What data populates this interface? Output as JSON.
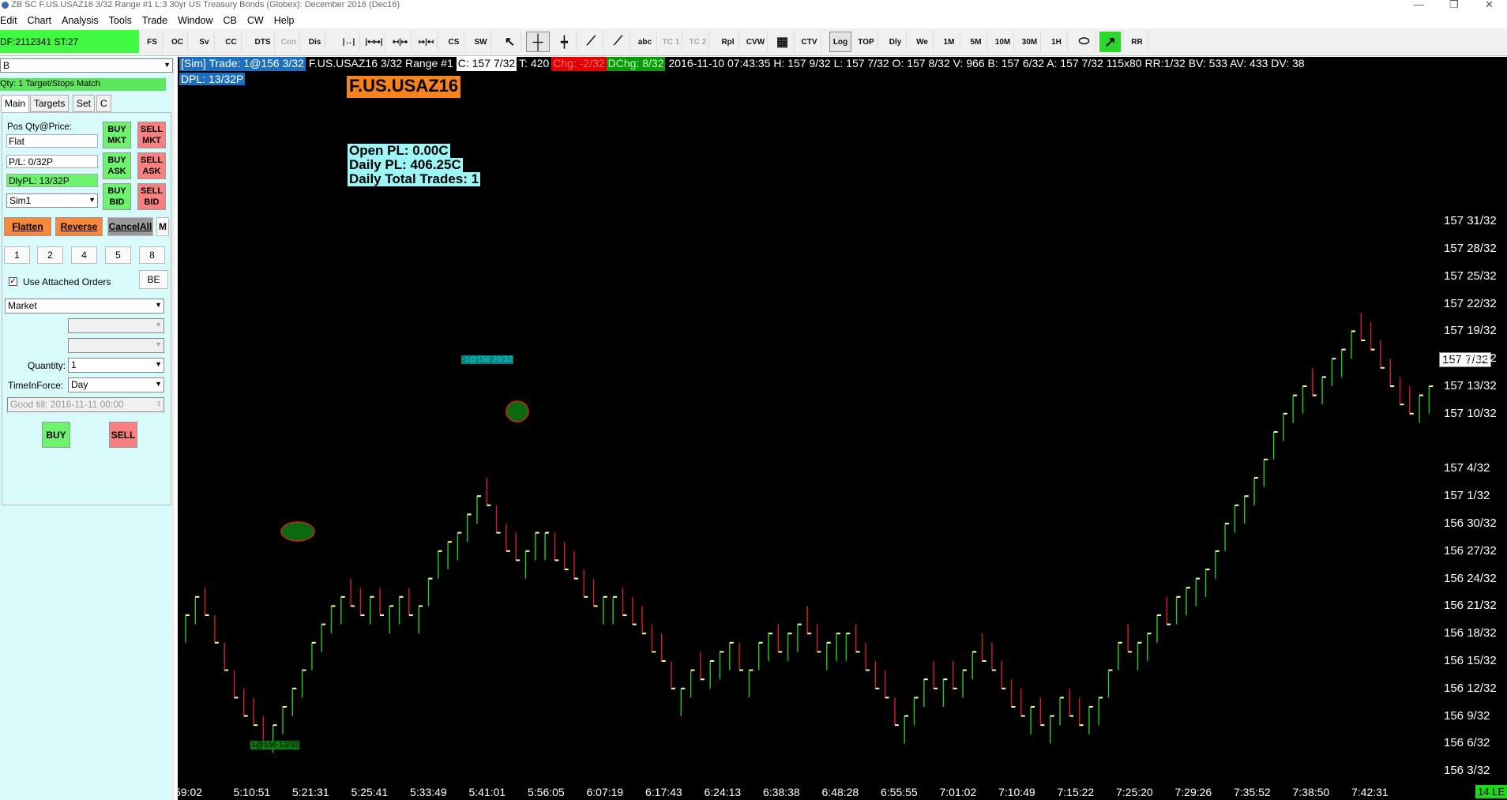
{
  "window": {
    "title": "ZB  SC F.US.USAZ16  3/32 Range  #1  L:3  30yr US Treasury Bonds (Globex): December 2016 (Dec16)"
  },
  "menu": [
    "Edit",
    "Chart",
    "Analysis",
    "Tools",
    "Trade",
    "Window",
    "CB",
    "CW",
    "Help"
  ],
  "account_bar": "DF:2112341  ST:27",
  "toolbar": [
    "FS",
    "OC",
    "Sv",
    "CC",
    "DTS",
    "Con",
    "Dis",
    "CS",
    "SW",
    "abc",
    "TC 1",
    "TC 2",
    "Rpl",
    "CVW",
    "CTV",
    "Log",
    "TOP",
    "Dly",
    "We",
    "1M",
    "5M",
    "10M",
    "30M",
    "1H",
    "RR"
  ],
  "trade_panel": {
    "symbol_select": "B",
    "target_status": "Qty: 1 Target/Stops Match",
    "tabs": [
      "Main",
      "Targets",
      "Set",
      "C"
    ],
    "pos_label": "Pos Qty@Price:",
    "pos_value": "Flat",
    "pl_value": "P/L: 0/32P",
    "dlypl_value": "DlyPL: 13/32P",
    "account": "Sim1",
    "buy_mkt": "BUY MKT",
    "sell_mkt": "SELL MKT",
    "buy_ask": "BUY ASK",
    "sell_ask": "SELL ASK",
    "buy_bid": "BUY BID",
    "sell_bid": "SELL BID",
    "flatten": "Flatten",
    "reverse": "Reverse",
    "cancel_all": "CancelAll",
    "m": "M",
    "qty_buttons": [
      "1",
      "2",
      "4",
      "5",
      "8"
    ],
    "use_attached": "Use Attached Orders",
    "use_attached_checked": true,
    "be": "BE",
    "order_type": "Market",
    "quantity_label": "Quantity:",
    "quantity": "1",
    "tif_label": "TimeInForce:",
    "tif": "Day",
    "good_till": "Good till: 2016-11-11 00:00",
    "buy": "BUY",
    "sell": "SELL"
  },
  "chart_header": {
    "sim": "[Sim]  Trade: 1@156 3/32",
    "symbol_range": "F.US.USAZ16  3/32 Range  #1",
    "close": "C: 157 7/32",
    "t": "T: 420",
    "chg": "Chg: -2/32",
    "dchg": "DChg: 8/32",
    "stats": "2016-11-10 07:43:35 H: 157 9/32 L: 157 7/32 O: 157 8/32 V: 966 B: 157 6/32 A: 157 7/32 115x80 RR:1/32 BV: 533 AV: 433 DV: 38",
    "dpl": "DPL: 13/32P"
  },
  "chart_symbol_badge": "F.US.USAZ16",
  "pl_box": [
    "Open PL: 0.00C",
    "Daily PL: 406.25C",
    "Daily Total Trades: 1"
  ],
  "trade_marker_sell": "-1@156 26/32",
  "trade_marker_buy": "1@156 13/32",
  "status_corner": "14 LE",
  "last_price_label": "157 7/32",
  "colors": {
    "up": "#22cc22",
    "down": "#d62020",
    "close_tick": "#ffff99",
    "account": "#41f941",
    "badge": "#f7831e",
    "plbox": "#9ef5f5"
  },
  "chart_data": {
    "type": "bar",
    "price_axis_labels": [
      "157 31/32",
      "157 28/32",
      "157 25/32",
      "157 22/32",
      "157 19/32",
      "157 16/32",
      "157 13/32",
      "157 10/32",
      "157 4/32",
      "157 1/32",
      "156 30/32",
      "156 27/32",
      "156 24/32",
      "156 21/32",
      "156 18/32",
      "156 15/32",
      "156 12/32",
      "156 9/32",
      "156 6/32",
      "156 3/32"
    ],
    "time_axis_labels": [
      "59:02",
      "5:10:51",
      "5:21:31",
      "5:25:41",
      "5:33:49",
      "5:41:01",
      "5:56:05",
      "6:07:19",
      "6:17:43",
      "6:24:13",
      "6:38:38",
      "6:48:28",
      "6:55:55",
      "7:01:02",
      "7:10:49",
      "7:15:22",
      "7:25:20",
      "7:29:26",
      "7:35:52",
      "7:38:50",
      "7:42:31"
    ],
    "ylim": [
      156.0625,
      158.0
    ],
    "closes_32nds": [
      20,
      22,
      20,
      17,
      14,
      11,
      9,
      8,
      6,
      8,
      10,
      12,
      14,
      17,
      19,
      21,
      22,
      21,
      20,
      22,
      20,
      21,
      22,
      20,
      21,
      24,
      27,
      28,
      29,
      31,
      33,
      32,
      29,
      27,
      26,
      27,
      29,
      29,
      26,
      25,
      24,
      22,
      21,
      22,
      22,
      20,
      19,
      18,
      16,
      15,
      12,
      12,
      14,
      13,
      15,
      16,
      17,
      14,
      14,
      17,
      18,
      16,
      18,
      19,
      18,
      16,
      17,
      18,
      18,
      16,
      14,
      12,
      11,
      8,
      9,
      11,
      13,
      12,
      13,
      12,
      14,
      16,
      15,
      14,
      12,
      10,
      9,
      10,
      8,
      9,
      11,
      9,
      8,
      10,
      11,
      14,
      17,
      16,
      17,
      18,
      20,
      19,
      22,
      23,
      24,
      25,
      27,
      30,
      32,
      33,
      35,
      37,
      40,
      42,
      44,
      45,
      44,
      46,
      48,
      49,
      51,
      50,
      49,
      47,
      45,
      43,
      42,
      44,
      45
    ],
    "buy_fill": {
      "time": "5:21:31",
      "price": "156 13/32"
    },
    "sell_fill": {
      "time": "5:56:05",
      "price": "156 26/32"
    }
  }
}
